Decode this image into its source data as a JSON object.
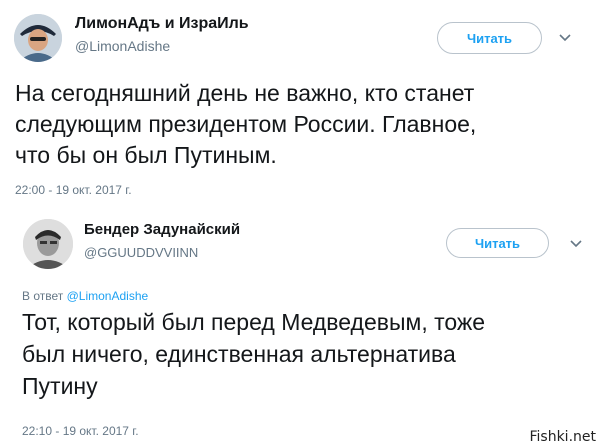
{
  "tweets": [
    {
      "author_name": "ЛимонАдъ и ИзраИль",
      "author_handle": "@LimonAdishe",
      "follow_label": "Читать",
      "reply_to_prefix": "",
      "reply_to_handle": "",
      "lines": [
        "На сегодняшний день не важно, кто станет",
        "следующим президентом России. Главное,",
        "что бы он был Путиным."
      ],
      "timestamp": "22:00 - 19 окт. 2017 г."
    },
    {
      "author_name": "Бендер Задунайский",
      "author_handle": "@GGUUDDVVIINN",
      "follow_label": "Читать",
      "reply_to_prefix": "В ответ",
      "reply_to_handle": "@LimonAdishe",
      "lines": [
        "Тот, который был перед Медведевым, тоже",
        "был ничего, единственная альтернатива",
        "Путину"
      ],
      "timestamp": "22:10 - 19 окт. 2017 г."
    }
  ],
  "watermark": "Fishki.net",
  "colors": {
    "accent": "#1da1f2",
    "text": "#14171a",
    "muted": "#657786"
  }
}
